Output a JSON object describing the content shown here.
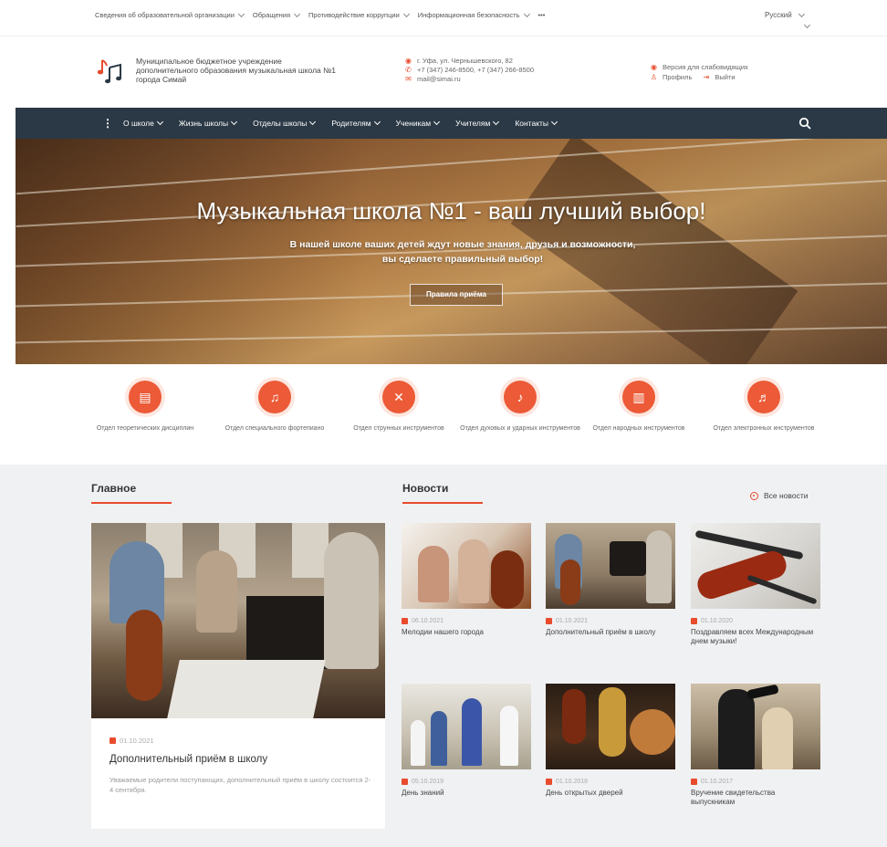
{
  "topbar": {
    "menu": [
      "Сведения об образовательной организации",
      "Обращения",
      "Противодействие коррупции",
      "Информационная безопасность"
    ],
    "more": "•••",
    "language": "Русский"
  },
  "header": {
    "org_line1": "Муниципальное бюджетное учреждение",
    "org_line2": "дополнительного образования музыкальная школа №1",
    "org_line3": "города Симай",
    "address": "г. Уфа, ул. Чернышевского, 82",
    "phones": "+7 (347) 246-8500, +7 (347) 266-8500",
    "email": "mail@simai.ru",
    "accessibility": "Версия для слабовидящих",
    "profile": "Профиль",
    "logout": "Выйти"
  },
  "nav": {
    "items": [
      "О школе",
      "Жизнь школы",
      "Отделы школы",
      "Родителям",
      "Ученикам",
      "Учителям",
      "Контакты"
    ]
  },
  "hero": {
    "title": "Музыкальная школа №1 - ваш лучший выбор!",
    "subtitle": "В нашей школе ваших детей ждут новые знания, друзья и возможности, вы сделаете правильный выбор!",
    "button": "Правила приёма"
  },
  "departments": [
    {
      "label": "Отдел теоретических дисциплин",
      "icon": "music-sheet-icon"
    },
    {
      "label": "Отдел специального фортепиано",
      "icon": "piano-icon"
    },
    {
      "label": "Отдел струнных инструментов",
      "icon": "violin-icon"
    },
    {
      "label": "Отдел духовых и ударных инструментов",
      "icon": "saxophone-icon"
    },
    {
      "label": "Отдел народных инструментов",
      "icon": "accordion-icon"
    },
    {
      "label": "Отдел электронных инструментов",
      "icon": "synthesizer-icon"
    }
  ],
  "main_section": {
    "heading": "Главное",
    "date": "01.10.2021",
    "title": "Дополнительный приём в школу",
    "text": "Уважаемые родители поступающих, дополнительный приём в школу состоится 2-4 сентября."
  },
  "news_section": {
    "heading": "Новости",
    "all_news": "Все новости",
    "items": [
      {
        "date": "06.10.2021",
        "title": "Мелодии нашего города"
      },
      {
        "date": "01.10.2021",
        "title": "Дополнительный приём в школу"
      },
      {
        "date": "01.10.2020",
        "title": "Поздравляем всех Международным днем музыки!"
      },
      {
        "date": "05.10.2019",
        "title": "День знаний"
      },
      {
        "date": "01.10.2018",
        "title": "День открытых дверей"
      },
      {
        "date": "01.10.2017",
        "title": "Вручение свидетельства выпускникам"
      }
    ]
  },
  "colors": {
    "accent": "#e84c2d",
    "nav_bg": "#2b3946",
    "content_bg": "#f0f1f2"
  }
}
